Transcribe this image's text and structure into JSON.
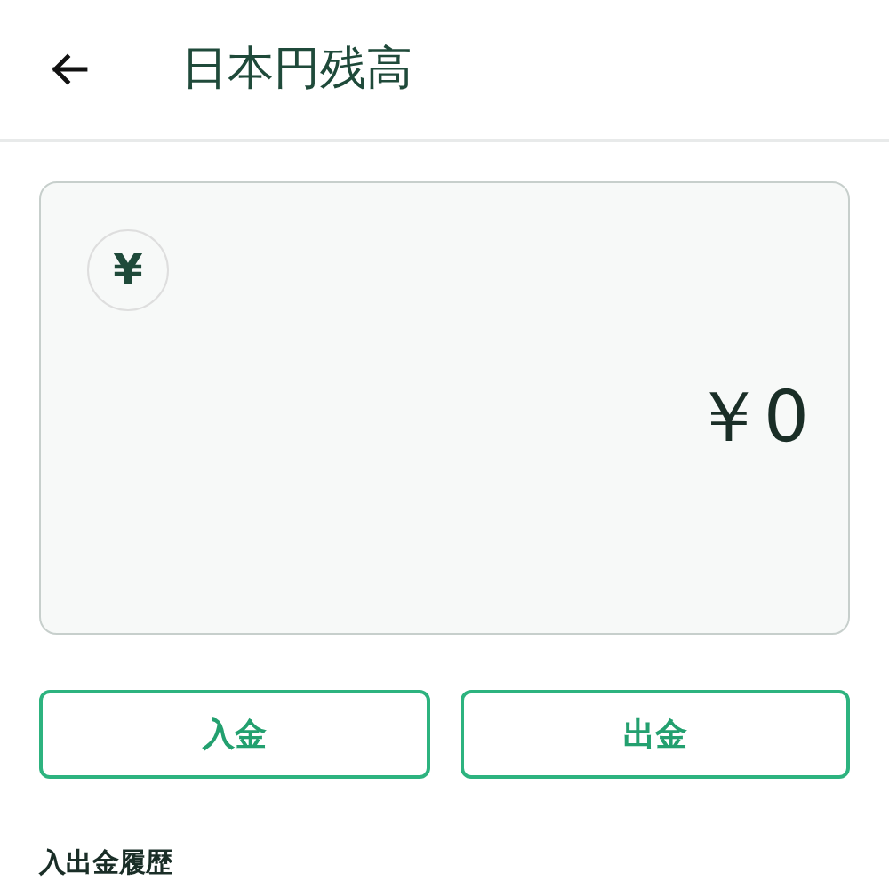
{
  "header": {
    "title": "日本円残高"
  },
  "balance_card": {
    "currency_symbol": "¥",
    "amount": "￥0"
  },
  "buttons": [
    "入金",
    "出金"
  ],
  "section_title": "入出金履歴"
}
